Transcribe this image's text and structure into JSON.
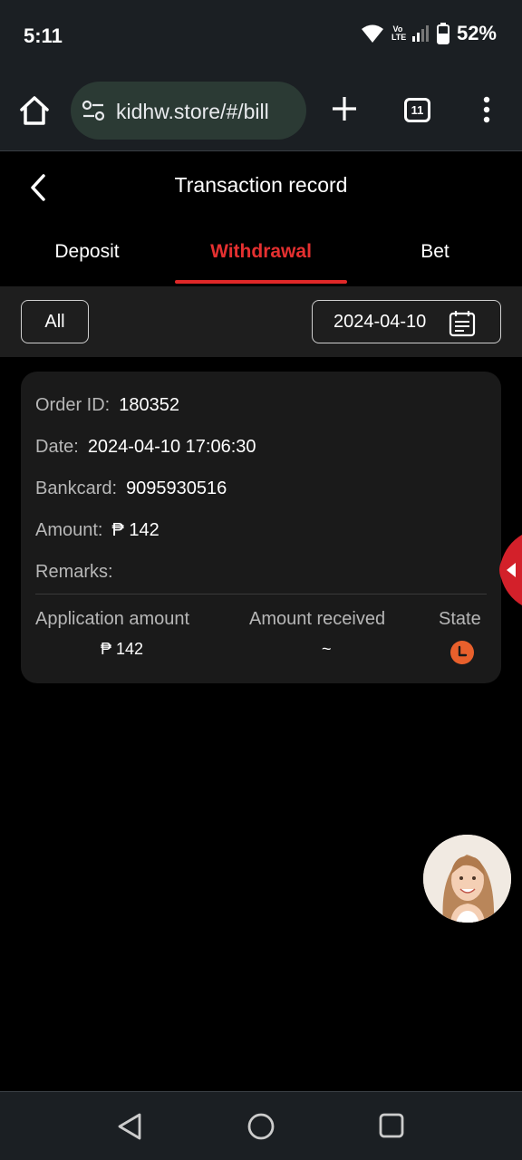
{
  "status_bar": {
    "time": "5:11",
    "volte_line1": "Vo",
    "volte_line2": "LTE",
    "battery_pct": "52%"
  },
  "browser": {
    "url": "kidhw.store/#/bill",
    "tab_count": "11"
  },
  "header": {
    "title": "Transaction record"
  },
  "tabs": [
    {
      "label": "Deposit",
      "active": false
    },
    {
      "label": "Withdrawal",
      "active": true
    },
    {
      "label": "Bet",
      "active": false
    }
  ],
  "filters": {
    "type_label": "All",
    "date": "2024-04-10"
  },
  "record": {
    "order_id_label": "Order ID:",
    "order_id": "180352",
    "date_label": "Date:",
    "date": "2024-04-10 17:06:30",
    "bankcard_label": "Bankcard:",
    "bankcard": "9095930516",
    "amount_label": "Amount:",
    "amount": "₱ 142",
    "remarks_label": "Remarks:",
    "remarks": "",
    "columns": {
      "application_amount": "Application amount",
      "amount_received": "Amount received",
      "state": "State"
    },
    "values": {
      "application_amount": "₱ 142",
      "amount_received": "~",
      "state_icon": "pending-clock-icon"
    }
  },
  "colors": {
    "accent": "#e53030",
    "state_pending": "#e8602c",
    "card_bg": "#1a1a1a"
  }
}
